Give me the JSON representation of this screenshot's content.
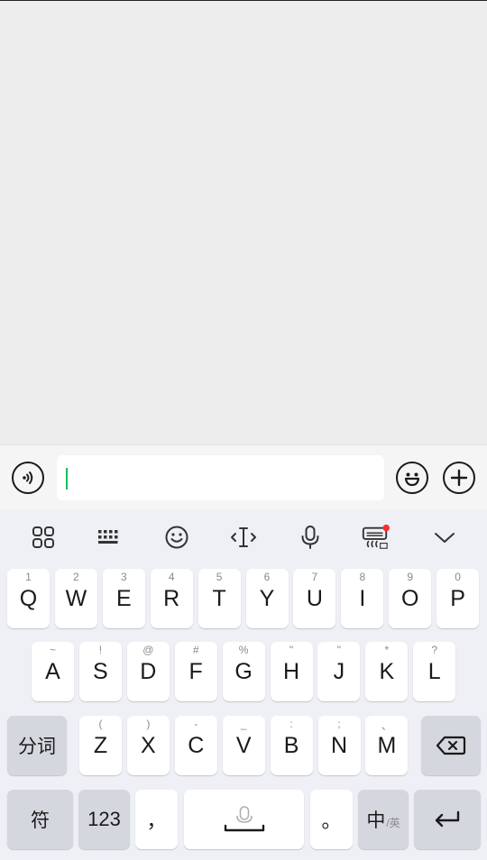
{
  "input": {
    "value": ""
  },
  "keyboard": {
    "row1": [
      {
        "letter": "Q",
        "hint": "1"
      },
      {
        "letter": "W",
        "hint": "2"
      },
      {
        "letter": "E",
        "hint": "3"
      },
      {
        "letter": "R",
        "hint": "4"
      },
      {
        "letter": "T",
        "hint": "5"
      },
      {
        "letter": "Y",
        "hint": "6"
      },
      {
        "letter": "U",
        "hint": "7"
      },
      {
        "letter": "I",
        "hint": "8"
      },
      {
        "letter": "O",
        "hint": "9"
      },
      {
        "letter": "P",
        "hint": "0"
      }
    ],
    "row2": [
      {
        "letter": "A",
        "hint": "~"
      },
      {
        "letter": "S",
        "hint": "!"
      },
      {
        "letter": "D",
        "hint": "@"
      },
      {
        "letter": "F",
        "hint": "#"
      },
      {
        "letter": "G",
        "hint": "%"
      },
      {
        "letter": "H",
        "hint": "\""
      },
      {
        "letter": "J",
        "hint": "\""
      },
      {
        "letter": "K",
        "hint": "*"
      },
      {
        "letter": "L",
        "hint": "?"
      }
    ],
    "row3": [
      {
        "letter": "Z",
        "hint": "("
      },
      {
        "letter": "X",
        "hint": ")"
      },
      {
        "letter": "C",
        "hint": "-"
      },
      {
        "letter": "V",
        "hint": "_"
      },
      {
        "letter": "B",
        "hint": ":"
      },
      {
        "letter": "N",
        "hint": ";"
      },
      {
        "letter": "M",
        "hint": "、"
      }
    ],
    "segment_label": "分词",
    "symbols_label": "符",
    "numbers_label": "123",
    "comma": "，",
    "period": "。",
    "lang_primary": "中",
    "lang_secondary": "/英"
  },
  "colors": {
    "caret": "#07c160",
    "notification_dot": "#ff2d2d"
  }
}
